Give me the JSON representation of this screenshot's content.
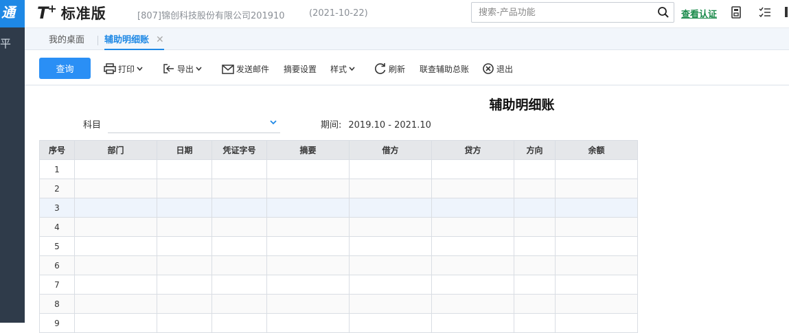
{
  "sidebar": {
    "brand": "通",
    "glyph": "平"
  },
  "header": {
    "logo_t": "T",
    "logo_plus": "+",
    "logo_edition": "标准版",
    "company": "[807]锦创科技股份有限公司201910",
    "date": "(2021-10-22)",
    "search_placeholder": "搜索-产品功能",
    "verify_link": "查看认证",
    "icons": [
      "search-icon",
      "calculator-icon",
      "checklist-icon",
      "bookmark-icon"
    ]
  },
  "tabs": [
    {
      "label": "我的桌面",
      "active": false
    },
    {
      "label": "辅助明细账",
      "active": true,
      "close": "✕"
    }
  ],
  "toolbar": {
    "query": "查询",
    "print": "打印",
    "export": "导出",
    "send_email": "发送邮件",
    "summary_settings": "摘要设置",
    "style": "样式",
    "refresh": "刷新",
    "linked_aux_ledger": "联查辅助总账",
    "exit": "退出"
  },
  "report": {
    "title": "辅助明细账",
    "subject_label": "科目",
    "subject_value": "",
    "period_label": "期间:",
    "period_value": "2019.10 - 2021.10"
  },
  "table": {
    "columns": [
      "序号",
      "部门",
      "日期",
      "凭证字号",
      "摘要",
      "借方",
      "贷方",
      "方向",
      "余额"
    ],
    "rows": [
      "1",
      "2",
      "3",
      "4",
      "5",
      "6",
      "7",
      "8",
      "9"
    ],
    "selected_row": "3"
  },
  "colors": {
    "accent": "#1e88e5",
    "button": "#2a8ff5",
    "verify": "#1a8a4a",
    "sidebar": "#2f3b4a"
  }
}
